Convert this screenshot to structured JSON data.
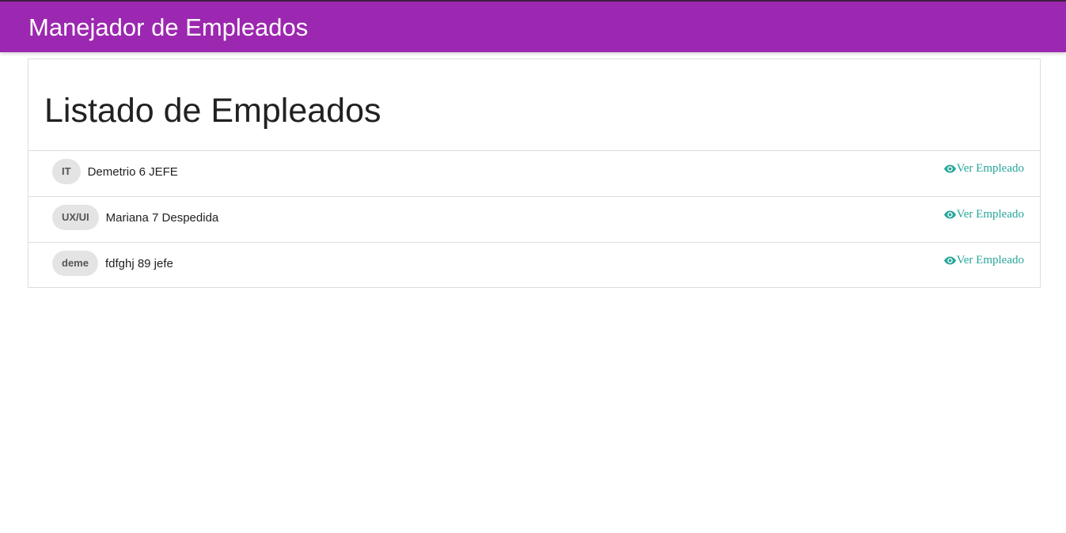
{
  "header": {
    "title": "Manejador de Empleados",
    "bg_color": "#9c27b0"
  },
  "main": {
    "title": "Listado de Empleados",
    "employees": [
      {
        "badge": "IT",
        "text": "Demetrio 6 JEFE",
        "link_label": "Ver Empleado",
        "link_icon": "eye-icon"
      },
      {
        "badge": "UX/UI",
        "text": "Mariana 7 Despedida",
        "link_label": "Ver Empleado",
        "link_icon": "eye-icon"
      },
      {
        "badge": "deme",
        "text": "fdfghj 89 jefe",
        "link_label": "Ver Empleado",
        "link_icon": "eye-icon"
      }
    ],
    "link_color": "#26a69a"
  }
}
